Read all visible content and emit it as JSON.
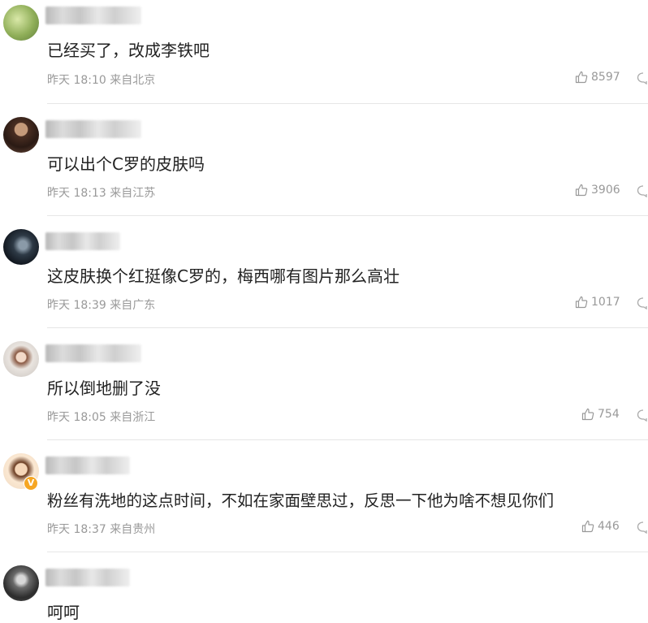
{
  "comments": [
    {
      "text": "已经买了，改成李铁吧",
      "time": "昨天 18:10",
      "location": "来自北京",
      "likes": "8597",
      "verified": false
    },
    {
      "text": "可以出个C罗的皮肤吗",
      "time": "昨天 18:13",
      "location": "来自江苏",
      "likes": "3906",
      "verified": false
    },
    {
      "text": "这皮肤换个红挺像C罗的，梅西哪有图片那么高壮",
      "time": "昨天 18:39",
      "location": "来自广东",
      "likes": "1017",
      "verified": false
    },
    {
      "text": "所以倒地删了没",
      "time": "昨天 18:05",
      "location": "来自浙江",
      "likes": "754",
      "verified": false
    },
    {
      "text": "粉丝有洗地的这点时间，不如在家面壁思过，反思一下他为啥不想见你们",
      "time": "昨天 18:37",
      "location": "来自贵州",
      "likes": "446",
      "verified": true
    },
    {
      "text": "呵呵",
      "time": "",
      "location": "",
      "likes": "",
      "verified": false
    }
  ],
  "colors": {
    "meta": "#999999",
    "text": "#222222",
    "divider": "#e6e6e6",
    "verified_badge": "#f6a623"
  }
}
